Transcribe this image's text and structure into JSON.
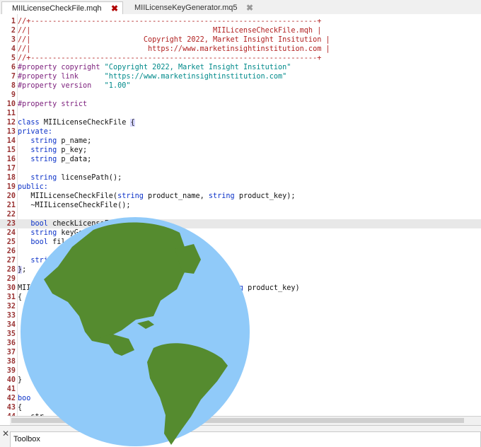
{
  "tabs": [
    {
      "label": "MIILicenseCheckFile.mqh",
      "close": "✖"
    },
    {
      "label": "MIILicenseKeyGenerator.mq5",
      "close": "✖"
    }
  ],
  "lines": [
    {
      "n": "1",
      "t": [
        [
          "c",
          "//+------------------------------------------------------------------+"
        ]
      ]
    },
    {
      "n": "2",
      "t": [
        [
          "c",
          "//|                                          MIILicenseCheckFile.mqh |"
        ]
      ]
    },
    {
      "n": "3",
      "t": [
        [
          "c",
          "//|                          Copyright 2022, Market Insight Insitution |"
        ]
      ]
    },
    {
      "n": "4",
      "t": [
        [
          "c",
          "//|                           https://www.marketinsightinstitution.com |"
        ]
      ]
    },
    {
      "n": "5",
      "t": [
        [
          "c",
          "//+------------------------------------------------------------------+"
        ]
      ]
    },
    {
      "n": "6",
      "t": [
        [
          "d",
          "#property copyright "
        ],
        [
          "s",
          "\"Copyright 2022, Market Insight Insitution\""
        ]
      ]
    },
    {
      "n": "7",
      "t": [
        [
          "d",
          "#property link      "
        ],
        [
          "s",
          "\"https://www.marketinsightinstitution.com\""
        ]
      ]
    },
    {
      "n": "8",
      "t": [
        [
          "d",
          "#property version   "
        ],
        [
          "s",
          "\"1.00\""
        ]
      ]
    },
    {
      "n": "9",
      "t": []
    },
    {
      "n": "10",
      "t": [
        [
          "d",
          "#property strict"
        ]
      ]
    },
    {
      "n": "11",
      "t": []
    },
    {
      "n": "12",
      "t": [
        [
          "k",
          "class "
        ],
        [
          "p",
          "MIILicenseCheckFile "
        ],
        [
          "b",
          "{"
        ]
      ]
    },
    {
      "n": "13",
      "t": [
        [
          "k",
          "private:"
        ]
      ]
    },
    {
      "n": "14",
      "t": [
        [
          "p",
          "   "
        ],
        [
          "k",
          "string "
        ],
        [
          "p",
          "p_name;"
        ]
      ]
    },
    {
      "n": "15",
      "t": [
        [
          "p",
          "   "
        ],
        [
          "k",
          "string "
        ],
        [
          "p",
          "p_key;"
        ]
      ]
    },
    {
      "n": "16",
      "t": [
        [
          "p",
          "   "
        ],
        [
          "k",
          "string "
        ],
        [
          "p",
          "p_data;"
        ]
      ]
    },
    {
      "n": "17",
      "t": []
    },
    {
      "n": "18",
      "t": [
        [
          "p",
          "   "
        ],
        [
          "k",
          "string "
        ],
        [
          "p",
          "licensePath();"
        ]
      ]
    },
    {
      "n": "19",
      "t": [
        [
          "k",
          "public:"
        ]
      ]
    },
    {
      "n": "20",
      "t": [
        [
          "p",
          "   MIILicenseCheckFile("
        ],
        [
          "k",
          "string "
        ],
        [
          "p",
          "product_name, "
        ],
        [
          "k",
          "string "
        ],
        [
          "p",
          "product_key);"
        ]
      ]
    },
    {
      "n": "21",
      "t": [
        [
          "p",
          "   ~MIILicenseCheckFile();"
        ]
      ]
    },
    {
      "n": "22",
      "t": []
    },
    {
      "n": "23",
      "t": [
        [
          "p",
          "   "
        ],
        [
          "k",
          "bool "
        ],
        [
          "p",
          "checkLicenseFile();"
        ]
      ],
      "hl": true
    },
    {
      "n": "24",
      "t": [
        [
          "p",
          "   "
        ],
        [
          "k",
          "string "
        ],
        [
          "p",
          "keyGen"
        ]
      ]
    },
    {
      "n": "25",
      "t": [
        [
          "p",
          "   "
        ],
        [
          "k",
          "bool "
        ],
        [
          "p",
          "file"
        ]
      ]
    },
    {
      "n": "26",
      "t": []
    },
    {
      "n": "27",
      "t": [
        [
          "p",
          "   "
        ],
        [
          "k",
          "stri"
        ]
      ]
    },
    {
      "n": "28",
      "t": [
        [
          "b",
          "}"
        ],
        [
          "p",
          ";"
        ]
      ]
    },
    {
      "n": "29",
      "t": []
    },
    {
      "n": "30",
      "t": [
        [
          "p",
          "MII                                  ct_name, "
        ],
        [
          "k",
          "string "
        ],
        [
          "p",
          "product_key)"
        ]
      ]
    },
    {
      "n": "31",
      "t": [
        [
          "p",
          "{"
        ]
      ]
    },
    {
      "n": "32",
      "t": []
    },
    {
      "n": "33",
      "t": []
    },
    {
      "n": "34",
      "t": []
    },
    {
      "n": "35",
      "t": []
    },
    {
      "n": "36",
      "t": []
    },
    {
      "n": "37",
      "t": []
    },
    {
      "n": "38",
      "t": []
    },
    {
      "n": "39",
      "t": []
    },
    {
      "n": "40",
      "t": [
        [
          "p",
          "}"
        ]
      ]
    },
    {
      "n": "41",
      "t": []
    },
    {
      "n": "42",
      "t": [
        [
          "k",
          "boo"
        ]
      ]
    },
    {
      "n": "43",
      "t": [
        [
          "p",
          "{"
        ]
      ]
    },
    {
      "n": "44",
      "t": [
        [
          "p",
          "   str"
        ]
      ]
    }
  ],
  "toolbox": {
    "label": "Toolbox",
    "close": "✕"
  },
  "colors": {
    "comment": "#b12121",
    "directive": "#7b1d7b",
    "keyword": "#0c32c8",
    "string": "#008a8a",
    "line_number": "#9a3434",
    "globe_ocean": "#90caf9",
    "globe_land": "#558b2f"
  },
  "overlay_icon": "globe-icon"
}
